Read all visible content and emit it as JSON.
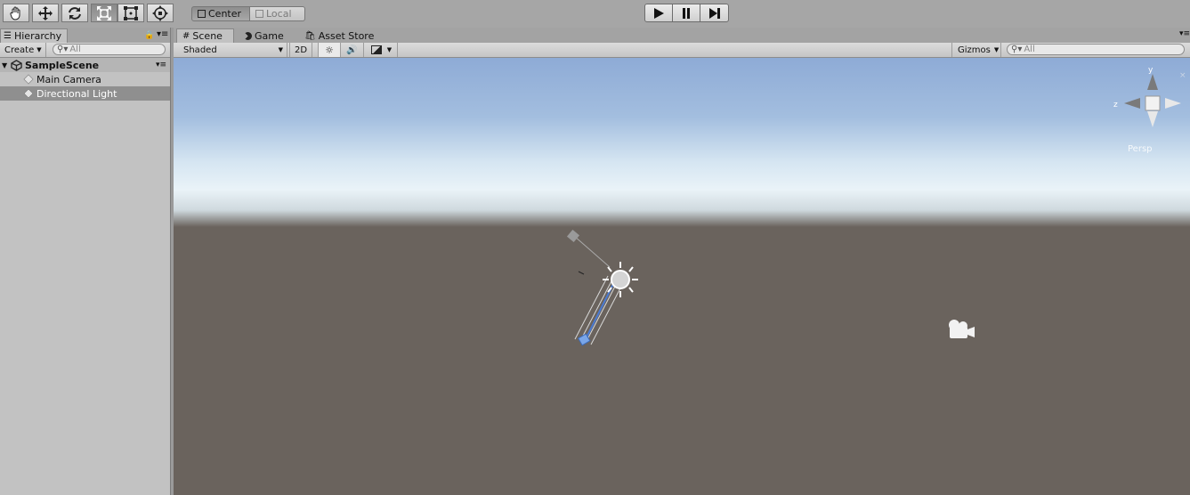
{
  "toolbar": {
    "tools": [
      {
        "name": "hand-tool",
        "icon": "hand-icon"
      },
      {
        "name": "move-tool",
        "icon": "move-arrows-icon"
      },
      {
        "name": "rotate-tool",
        "icon": "rotate-icon"
      },
      {
        "name": "scale-tool",
        "icon": "scale-icon",
        "active": true
      },
      {
        "name": "rect-tool",
        "icon": "rect-icon"
      },
      {
        "name": "transform-tool",
        "icon": "transform-icon"
      }
    ],
    "pivot_center": "Center",
    "pivot_local": "Local",
    "play_icons": [
      "play-icon",
      "pause-icon",
      "step-icon"
    ]
  },
  "hierarchy": {
    "tab_label": "Hierarchy",
    "create_label": "Create",
    "search_placeholder": "All",
    "scene_name": "SampleScene",
    "items": [
      {
        "label": "Main Camera",
        "selected": false
      },
      {
        "label": "Directional Light",
        "selected": true
      }
    ]
  },
  "scene_view": {
    "tabs": [
      {
        "label": "Scene",
        "icon": "grid-icon",
        "active": true
      },
      {
        "label": "Game",
        "icon": "pacman-icon",
        "active": false
      },
      {
        "label": "Asset Store",
        "icon": "store-bag-icon",
        "active": false
      }
    ],
    "shading_mode": "Shaded",
    "mode_2d": "2D",
    "gizmos_label": "Gizmos",
    "search_placeholder": "All",
    "orientation": {
      "y": "y",
      "z": "z",
      "projection": "Persp"
    }
  },
  "colors": {
    "ground": "#6a635d",
    "sky_top": "#8eabd6",
    "selection": "#8f8f8f"
  }
}
